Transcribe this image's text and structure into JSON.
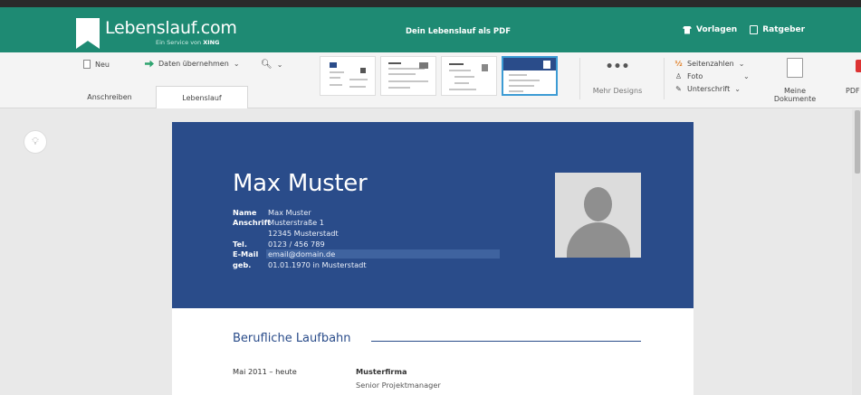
{
  "topbar": {
    "logo_name": "Lebenslauf.com",
    "logo_sub_prefix": "Ein Service von",
    "logo_sub_brand": "XING",
    "pdf_link": "Dein Lebenslauf als PDF",
    "vorlagen": "Vorlagen",
    "ratgeber": "Ratgeber",
    "bar_color": "#1e8a73"
  },
  "toolbar": {
    "neu": "Neu",
    "daten": "Daten übernehmen",
    "tabs": [
      {
        "label": "Anschreiben",
        "active": false
      },
      {
        "label": "Lebenslauf",
        "active": true
      }
    ],
    "mehr_designs": "Mehr Designs",
    "more_dots": "•••",
    "options": [
      {
        "icon": "page-numbers-icon",
        "label": "Seitenzahlen"
      },
      {
        "icon": "photo-person-icon",
        "label": "Foto"
      },
      {
        "icon": "pen-icon",
        "label": "Unterschrift"
      }
    ],
    "meine_dokumente": "Meine Dokumente",
    "pdf_cut": "PDF"
  },
  "resume": {
    "header_color": "#2a4c8a",
    "name": "Max Muster",
    "info": [
      {
        "label": "Name",
        "value": "Max Muster"
      },
      {
        "label": "Anschrift",
        "value": "Musterstraße 1"
      },
      {
        "label": "",
        "value": "12345 Musterstadt"
      },
      {
        "label": "Tel.",
        "value": "0123 / 456 789"
      },
      {
        "label": "E-Mail",
        "value": "email@domain.de"
      },
      {
        "label": "geb.",
        "value": "01.01.1970 in Musterstadt"
      }
    ],
    "section_title": "Berufliche Laufbahn",
    "entry": {
      "date": "Mai 2011 – heute",
      "company": "Musterfirma",
      "role": "Senior Projektmanager"
    }
  }
}
